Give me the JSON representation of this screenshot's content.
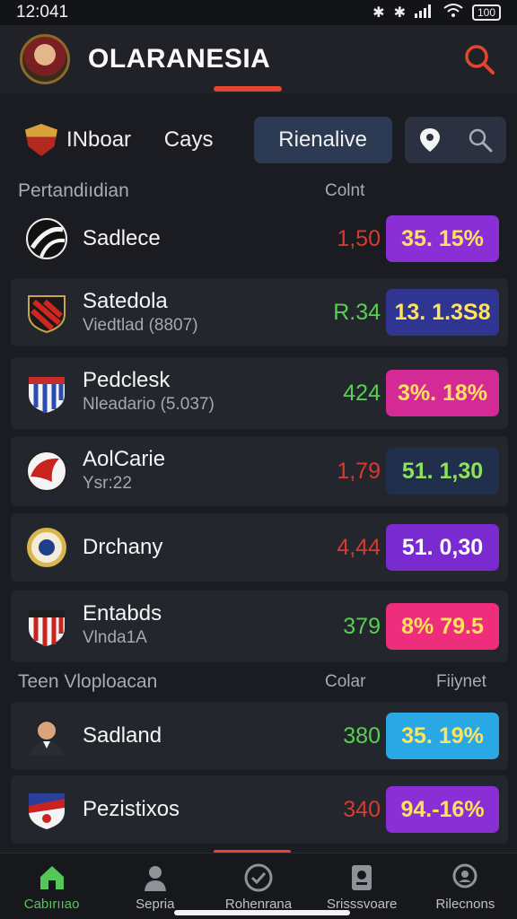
{
  "status_bar": {
    "time": "12:041",
    "battery": "100"
  },
  "app": {
    "title": "OLARANESIA",
    "accent": "#e2462d"
  },
  "tabs": [
    {
      "label": "INboar",
      "icon": "team-crest-icon"
    },
    {
      "label": "Cays"
    },
    {
      "label": "Rienalive",
      "selected": true
    }
  ],
  "section1": {
    "title": "Pertandiıdian",
    "col2": "Colnt"
  },
  "matches": [
    {
      "name": "Sadlece",
      "subtitle": "",
      "odds": "1,50",
      "odds_color": "#d83a2e",
      "pill": "35. 15%",
      "pill_bg": "#8a2fd6",
      "pill_color": "#ffe35a",
      "logo": "black-white-ball-icon"
    },
    {
      "name": "Satedola",
      "subtitle": "Viedtlad (8807)",
      "odds": "R.34",
      "odds_color": "#54d24f",
      "pill": "13. 1.3S8",
      "pill_bg": "#2f3590",
      "pill_color": "#ffe35a",
      "logo": "red-black-crest-icon"
    },
    {
      "name": "Pedclesk",
      "subtitle": "Nleadario (5.037)",
      "odds": "424",
      "odds_color": "#54d24f",
      "pill": "3%. 18%",
      "pill_bg": "#d42a95",
      "pill_color": "#ffe35a",
      "logo": "red-blue-stripes-crest-icon"
    },
    {
      "name": "AolCarie",
      "subtitle": "Ysr:22",
      "odds": "1,79",
      "odds_color": "#d83a2e",
      "pill": "51. 1,30",
      "pill_bg": "#1f2f4c",
      "pill_color": "#8fe05c",
      "logo": "red-white-ball-icon"
    },
    {
      "name": "Drchany",
      "subtitle": "",
      "odds": "4,44",
      "odds_color": "#d83a2e",
      "pill": "51. 0,30",
      "pill_bg": "#7a2bd0",
      "pill_color": "#ffffff",
      "logo": "gold-blue-seal-icon"
    },
    {
      "name": "Entabds",
      "subtitle": "Vlnda1A",
      "odds": "379",
      "odds_color": "#54d24f",
      "pill": "8% 79.5",
      "pill_bg": "#ee2d7c",
      "pill_color": "#ffe35a",
      "logo": "red-white-stripes-crest-icon"
    }
  ],
  "section2": {
    "title": "Teen Vloploacan",
    "col2": "Colar",
    "col3": "Fiiynet"
  },
  "players": [
    {
      "name": "Sadland",
      "odds": "380",
      "odds_color": "#54d24f",
      "pill": "35. 19%",
      "pill_bg": "#2aa8e6",
      "pill_color": "#ffe35a",
      "logo": "player-portrait-icon"
    },
    {
      "name": "Pezistixos",
      "odds": "340",
      "odds_color": "#d83a2e",
      "pill": "94.-16%",
      "pill_bg": "#8a2fd6",
      "pill_color": "#ffe35a",
      "logo": "blue-red-crest-icon"
    }
  ],
  "bottom_nav": [
    {
      "label": "Cabırııao",
      "icon": "home-icon",
      "active": true
    },
    {
      "label": "Sepria",
      "icon": "people-icon"
    },
    {
      "label": "Rohenrana",
      "icon": "ball-icon"
    },
    {
      "label": "Srisssvoare",
      "icon": "badge-icon"
    },
    {
      "label": "Rilecnons",
      "icon": "search-profile-icon"
    }
  ]
}
